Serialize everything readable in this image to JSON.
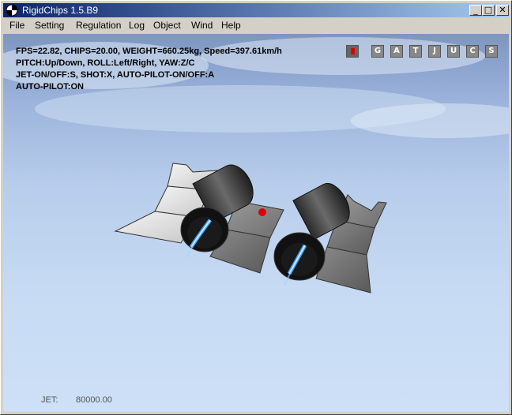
{
  "window": {
    "title": "RigidChips 1.5.B9",
    "buttons": {
      "minimize": "_",
      "maximize": "□",
      "close": "✕"
    }
  },
  "menu": [
    {
      "label": "File"
    },
    {
      "label": "Setting"
    },
    {
      "label": "Regulation"
    },
    {
      "label": "Log"
    },
    {
      "label": "Object"
    },
    {
      "label": "Wind"
    },
    {
      "label": "Help"
    }
  ],
  "hud": {
    "line1": "FPS=22.82, CHIPS=20.00, WEIGHT=660.25kg, Speed=397.61km/h",
    "line2": "PITCH:Up/Down, ROLL:Left/Right, YAW:Z/C",
    "line3": "JET-ON/OFF:S, SHOT:X, AUTO-PILOT-ON/OFF:A",
    "line4": "AUTO-PILOT:ON"
  },
  "keys": [
    "G",
    "A",
    "T",
    "J",
    "U",
    "C",
    "S"
  ],
  "status": {
    "jet_label": "JET:",
    "jet_value": "80000.00"
  },
  "colors": {
    "titlebar_start": "#0a246a",
    "titlebar_end": "#a6caf0",
    "sky_top": "#7d96c0",
    "sky_bottom": "#cde0f7",
    "record": "#e00000"
  }
}
